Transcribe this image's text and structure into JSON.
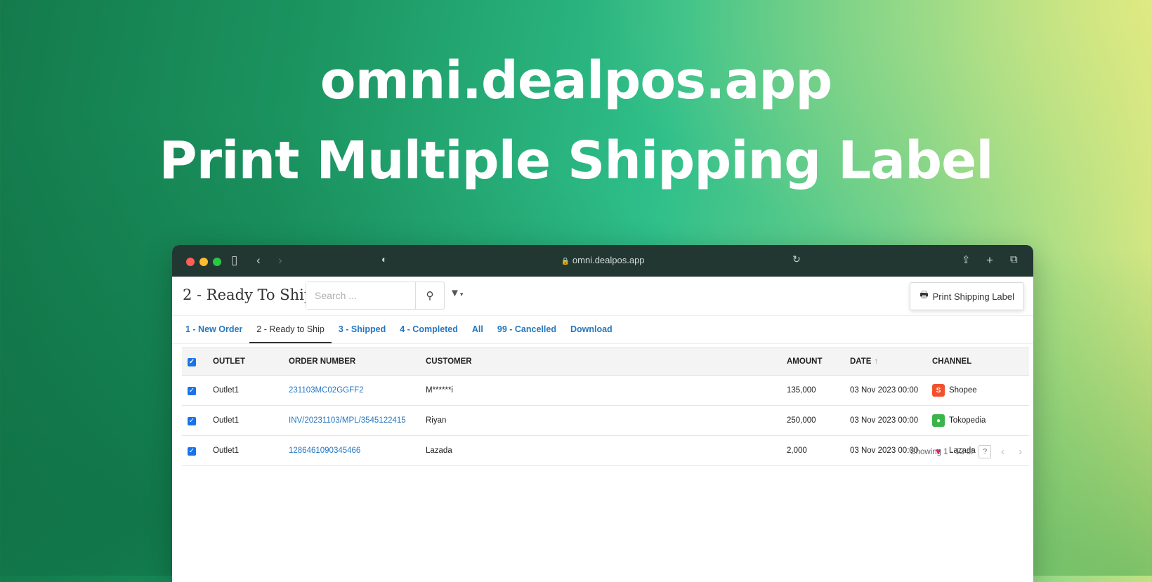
{
  "hero": {
    "line1": "omni.dealpos.app",
    "line2": "Print Multiple Shipping Label"
  },
  "browser": {
    "url": "omni.dealpos.app",
    "icons": [
      "sidebar-icon",
      "back-icon",
      "forward-icon",
      "shield-icon",
      "reload-icon",
      "share-icon",
      "new-tab-icon",
      "tabs-overview-icon"
    ]
  },
  "toolbar": {
    "title": "2 - Ready To Ship",
    "search_placeholder": "Search ...",
    "print_label": "Print Shipping Label"
  },
  "tabs": [
    {
      "label": "1 - New Order",
      "active": false
    },
    {
      "label": "2 - Ready to Ship",
      "active": true
    },
    {
      "label": "3 - Shipped",
      "active": false
    },
    {
      "label": "4 - Completed",
      "active": false
    },
    {
      "label": "All",
      "active": false
    },
    {
      "label": "99 - Cancelled",
      "active": false
    },
    {
      "label": "Download",
      "active": false
    }
  ],
  "table": {
    "columns": [
      "OUTLET",
      "ORDER NUMBER",
      "CUSTOMER",
      "AMOUNT",
      "DATE",
      "CHANNEL"
    ],
    "rows": [
      {
        "outlet": "Outlet1",
        "order": "231103MC02GGFF2",
        "customer": "M******i",
        "amount": "135,000",
        "date": "03 Nov 2023 00:00",
        "channel": "Shopee",
        "checked": true
      },
      {
        "outlet": "Outlet1",
        "order": "INV/20231103/MPL/3545122415",
        "customer": "Riyan",
        "amount": "250,000",
        "date": "03 Nov 2023 00:00",
        "channel": "Tokopedia",
        "checked": true
      },
      {
        "outlet": "Outlet1",
        "order": "1286461090345466",
        "customer": "Lazada",
        "amount": "2,000",
        "date": "03 Nov 2023 00:00",
        "channel": "Lazada",
        "checked": true
      }
    ]
  },
  "pager": {
    "text": "Showing 1 - 13 of",
    "total": "?"
  }
}
